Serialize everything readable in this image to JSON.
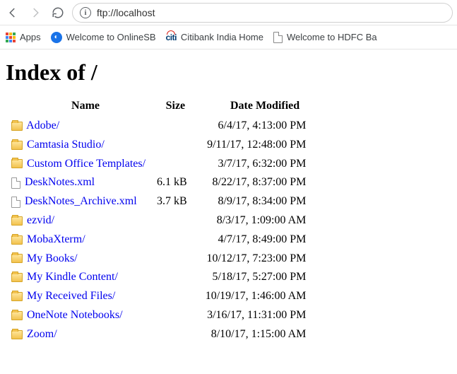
{
  "browser": {
    "url": "ftp://localhost",
    "bookmarks": {
      "apps": "Apps",
      "sbi": "Welcome to OnlineSB",
      "citi": "Citibank India Home",
      "hdfc": "Welcome to HDFC Ba"
    }
  },
  "page": {
    "heading": "Index of /",
    "columns": {
      "name": "Name",
      "size": "Size",
      "date": "Date Modified"
    },
    "rows": [
      {
        "icon": "folder",
        "name": "Adobe/",
        "size": "",
        "date": "6/4/17, 4:13:00 PM"
      },
      {
        "icon": "folder",
        "name": "Camtasia Studio/",
        "size": "",
        "date": "9/11/17, 12:48:00 PM"
      },
      {
        "icon": "folder",
        "name": "Custom Office Templates/",
        "size": "",
        "date": "3/7/17, 6:32:00 PM"
      },
      {
        "icon": "file",
        "name": "DeskNotes.xml",
        "size": "6.1 kB",
        "date": "8/22/17, 8:37:00 PM"
      },
      {
        "icon": "file",
        "name": "DeskNotes_Archive.xml",
        "size": "3.7 kB",
        "date": "8/9/17, 8:34:00 PM"
      },
      {
        "icon": "folder",
        "name": "ezvid/",
        "size": "",
        "date": "8/3/17, 1:09:00 AM"
      },
      {
        "icon": "folder",
        "name": "MobaXterm/",
        "size": "",
        "date": "4/7/17, 8:49:00 PM"
      },
      {
        "icon": "folder",
        "name": "My Books/",
        "size": "",
        "date": "10/12/17, 7:23:00 PM"
      },
      {
        "icon": "folder",
        "name": "My Kindle Content/",
        "size": "",
        "date": "5/18/17, 5:27:00 PM"
      },
      {
        "icon": "folder",
        "name": "My Received Files/",
        "size": "",
        "date": "10/19/17, 1:46:00 AM"
      },
      {
        "icon": "folder",
        "name": "OneNote Notebooks/",
        "size": "",
        "date": "3/16/17, 11:31:00 PM"
      },
      {
        "icon": "folder",
        "name": "Zoom/",
        "size": "",
        "date": "8/10/17, 1:15:00 AM"
      }
    ]
  }
}
